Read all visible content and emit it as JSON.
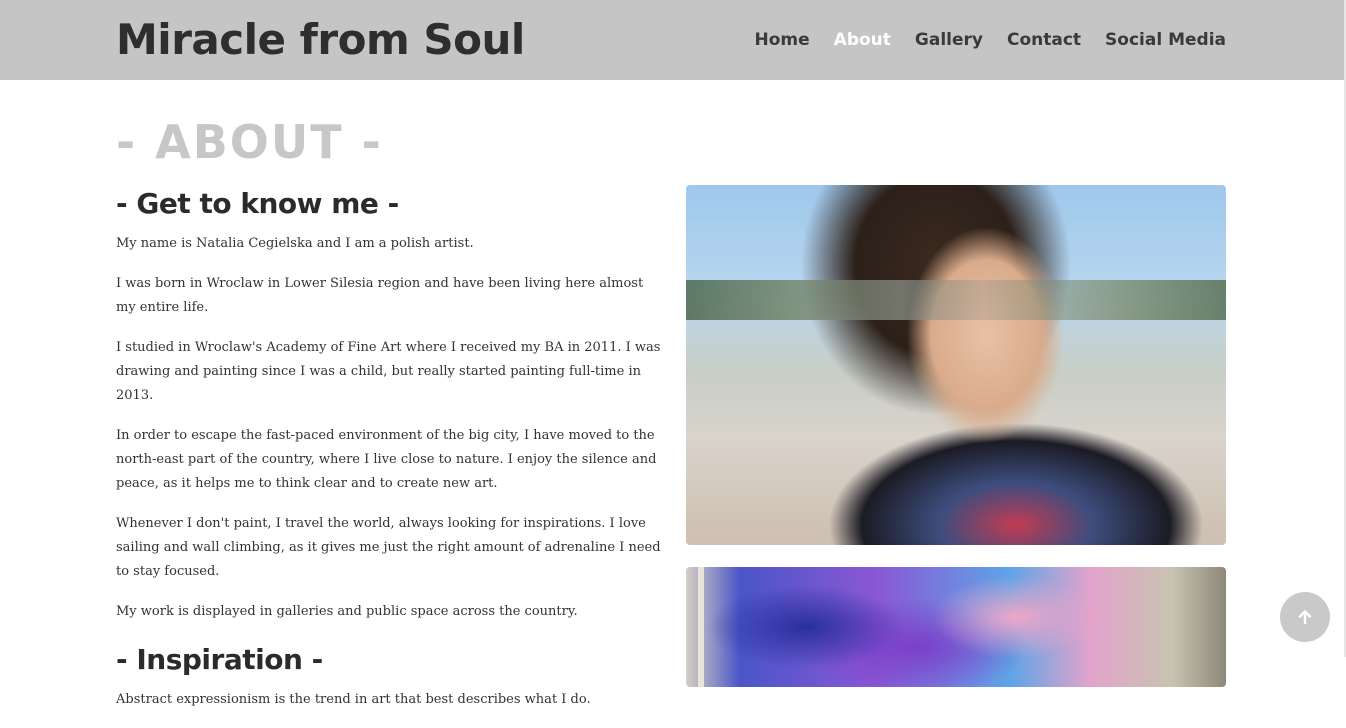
{
  "header": {
    "brand": "Miracle from Soul",
    "nav": [
      {
        "label": "Home",
        "active": false
      },
      {
        "label": "About",
        "active": true
      },
      {
        "label": "Gallery",
        "active": false
      },
      {
        "label": "Contact",
        "active": false
      },
      {
        "label": "Social Media",
        "active": false
      }
    ]
  },
  "page": {
    "heading": "- ABOUT -"
  },
  "about": {
    "title": "- Get to know me -",
    "paragraphs": [
      "My name is Natalia Cegielska and I am a polish artist.",
      "I was born in Wroclaw in Lower Silesia region and have been living here almost my entire life.",
      "I studied in Wroclaw's Academy of Fine Art where I received my BA in 2011. I was drawing and painting since I was a child, but really started painting full-time in 2013.",
      "In order to escape the fast-paced environment of the big city, I have moved to the north-east part of the country, where I live close to nature. I enjoy the silence and peace, as it helps me to think clear and to create new art.",
      "Whenever I don't paint, I travel the world, always looking for inspirations. I love sailing and wall climbing, as it gives me just the right amount of adrenaline I need to stay focused.",
      "My work is displayed in galleries and public space across the country."
    ]
  },
  "inspiration": {
    "title": "- Inspiration -",
    "paragraphs": [
      "Abstract expressionism is the trend in art that best describes what I do."
    ]
  },
  "images": {
    "portrait_icon": "photo-portrait",
    "painting_icon": "photo-painting"
  },
  "controls": {
    "to_top_icon": "arrow-up-icon"
  },
  "colors": {
    "header_bg": "#c5c5c5",
    "nav_active": "#ffffff",
    "heading_gray": "#c7c7c7",
    "to_top_bg": "#c9c9c9"
  }
}
